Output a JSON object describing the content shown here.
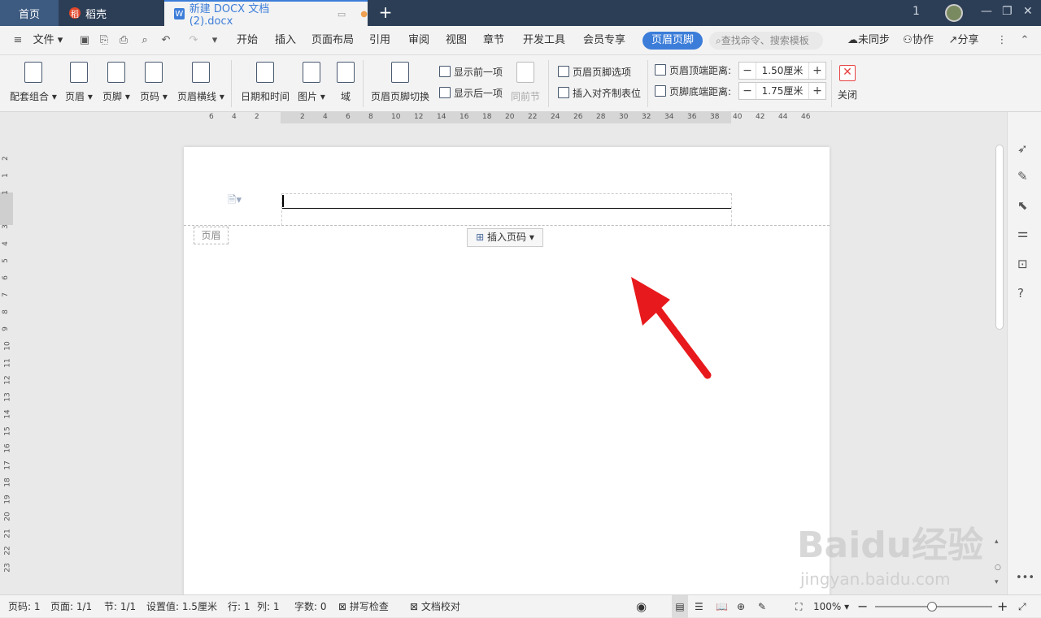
{
  "tabs": {
    "home": "首页",
    "daoke": "稻壳",
    "doc": "新建 DOCX 文档 (2).docx",
    "daoke_logo": "稻"
  },
  "menu": {
    "file": "文件",
    "items": [
      "开始",
      "插入",
      "页面布局",
      "引用",
      "审阅",
      "视图",
      "章节",
      "开发工具",
      "会员专享"
    ],
    "active": "页眉页脚",
    "search_placeholder": "查找命令、搜索模板",
    "sync": "未同步",
    "collab": "协作",
    "share": "分享"
  },
  "ribbon": {
    "combo": "配套组合",
    "header": "页眉",
    "footer": "页脚",
    "page_num": "页码",
    "header_line": "页眉横线",
    "datetime": "日期和时间",
    "picture": "图片",
    "field": "域",
    "switch": "页眉页脚切换",
    "show_prev": "显示前一项",
    "show_next": "显示后一项",
    "same_prev": "同前节",
    "options": "页眉页脚选项",
    "insert_align": "插入对齐制表位",
    "top_dist_label": "页眉顶端距离:",
    "top_dist_value": "1.50厘米",
    "bottom_dist_label": "页脚底端距离:",
    "bottom_dist_value": "1.75厘米",
    "close": "关闭"
  },
  "ruler": {
    "h": [
      "6",
      "4",
      "2",
      "",
      "2",
      "4",
      "6",
      "8",
      "10",
      "12",
      "14",
      "16",
      "18",
      "20",
      "22",
      "24",
      "26",
      "28",
      "30",
      "32",
      "34",
      "36",
      "38",
      "40",
      "42",
      "44",
      "46"
    ],
    "v": [
      "2",
      "1",
      "1",
      "",
      "3",
      "4",
      "5",
      "6",
      "7",
      "8",
      "9",
      "10",
      "11",
      "12",
      "13",
      "14",
      "15",
      "16",
      "17",
      "18",
      "19",
      "20",
      "21",
      "22",
      "23"
    ]
  },
  "page": {
    "header_tag": "页眉",
    "insert_page_num": "插入页码"
  },
  "status": {
    "page": "页码: 1",
    "pages": "页面: 1/1",
    "section": "节: 1/1",
    "setting": "设置值: 1.5厘米",
    "row": "行: 1",
    "col": "列: 1",
    "words": "字数: 0",
    "spell": "拼写检查",
    "proof": "文档校对",
    "zoom": "100%"
  },
  "watermark": {
    "brand": "Baidu经验",
    "url": "jingyan.baidu.com"
  },
  "colors": {
    "accent": "#3c7dd9",
    "titlebar": "#2c3e56",
    "arrow": "#e8191c"
  }
}
